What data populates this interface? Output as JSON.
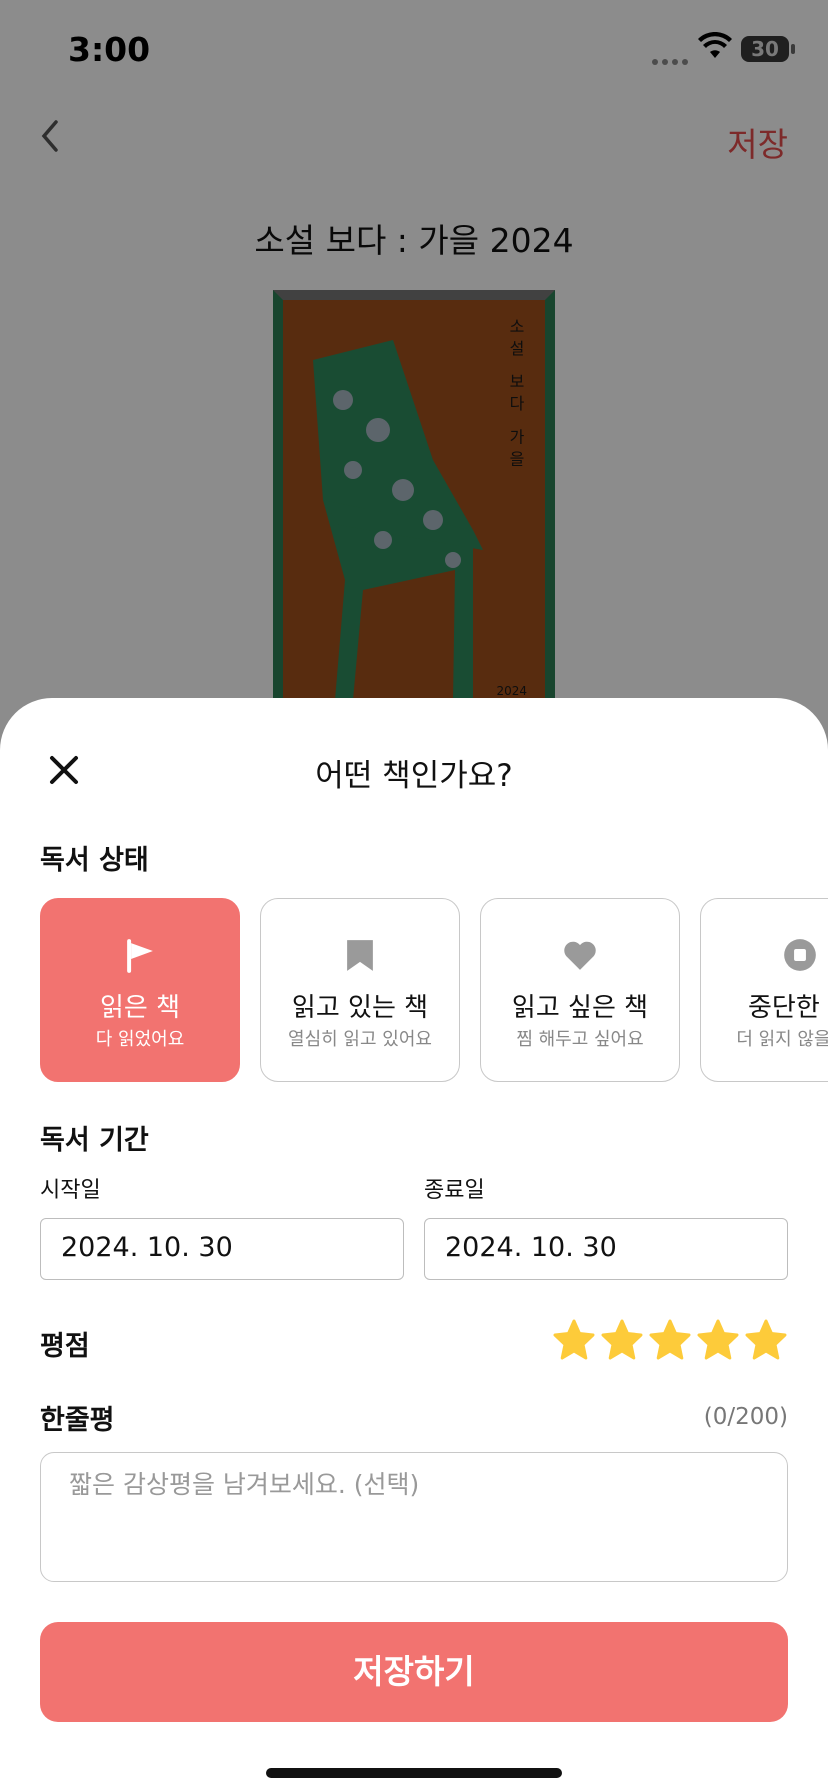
{
  "status_bar": {
    "time": "3:00",
    "battery": "30"
  },
  "header": {
    "save_label": "저장",
    "book_title": "소설 보다 : 가을 2024"
  },
  "cover": {
    "vertical_text": "소설 보다 가을",
    "year": "2024"
  },
  "sheet": {
    "title": "어떤 책인가요?",
    "reading_status_label": "독서 상태",
    "status_options": [
      {
        "title": "읽은 책",
        "subtitle": "다 읽었어요",
        "icon": "flag-icon",
        "selected": true
      },
      {
        "title": "읽고 있는 책",
        "subtitle": "열심히 읽고 있어요",
        "icon": "bookmark-icon",
        "selected": false
      },
      {
        "title": "읽고 싶은 책",
        "subtitle": "찜 해두고 싶어요",
        "icon": "heart-icon",
        "selected": false
      },
      {
        "title": "중단한 책",
        "subtitle": "더 읽지 않을래요",
        "icon": "stop-icon",
        "selected": false
      }
    ],
    "period_label": "독서 기간",
    "start_label": "시작일",
    "start_value": "2024. 10. 30",
    "end_label": "종료일",
    "end_value": "2024. 10. 30",
    "rating_label": "평점",
    "rating_value": 5,
    "review_label": "한줄평",
    "review_count": "(0/200)",
    "review_placeholder": "짧은 감상평을 남겨보세요. (선택)",
    "save_button": "저장하기"
  },
  "colors": {
    "accent": "#f27370",
    "star": "#fdcb3a",
    "save_text": "#e34d4d"
  }
}
